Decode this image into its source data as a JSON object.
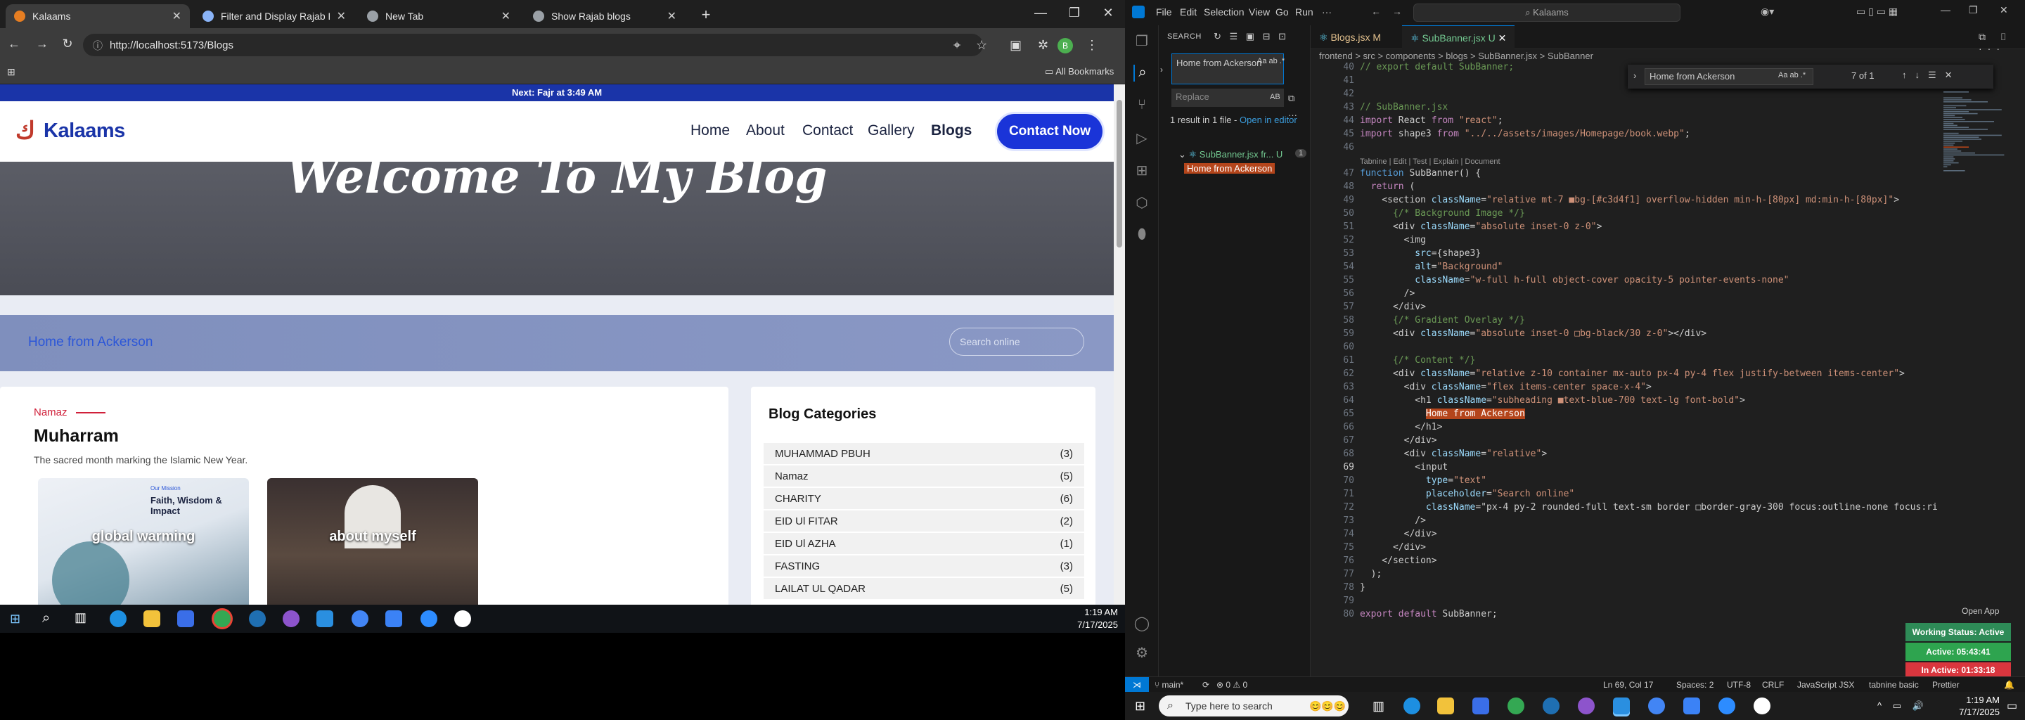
{
  "chrome": {
    "tabs": [
      {
        "title": "Kalaams",
        "active": true,
        "fav_color": "#e67e22"
      },
      {
        "title": "Filter and Display Rajab Blog In",
        "active": false,
        "fav_color": "#8ab4f8"
      },
      {
        "title": "New Tab",
        "active": false,
        "fav_color": "#9aa0a6"
      },
      {
        "title": "Show Rajab blogs",
        "active": false,
        "fav_color": "#9aa0a6"
      }
    ],
    "url": "http://localhost:5173/Blogs",
    "all_bookmarks": "All Bookmarks",
    "profile_initial": "B"
  },
  "site": {
    "prayer_banner": "Next: Fajr at 3:49 AM",
    "logo_text": "Kalaams",
    "nav": [
      "Home",
      "About",
      "Contact",
      "Gallery",
      "Blogs"
    ],
    "contact_button": "Contact Now",
    "hero_heading": "Welcome To My Blog",
    "subbanner_heading": "Home from Ackerson",
    "search_placeholder": "Search online",
    "post": {
      "category": "Namaz",
      "title": "Muharram",
      "description": "The sacred month marking the Islamic New Year.",
      "thumbs": [
        {
          "label": "global warming",
          "small_text": "Our Mission",
          "small_title": "Faith, Wisdom & Impact"
        },
        {
          "label": "about myself"
        }
      ]
    },
    "categories_title": "Blog Categories",
    "categories": [
      {
        "name": "MUHAMMAD PBUH",
        "count": "(3)"
      },
      {
        "name": "Namaz",
        "count": "(5)"
      },
      {
        "name": "CHARITY",
        "count": "(6)"
      },
      {
        "name": "EID Ul FITAR",
        "count": "(2)"
      },
      {
        "name": "EID Ul AZHA",
        "count": "(1)"
      },
      {
        "name": "FASTING",
        "count": "(3)"
      },
      {
        "name": "LAILAT UL QADAR",
        "count": "(5)"
      }
    ]
  },
  "taskbar_left": {
    "time": "1:19 AM",
    "date": "7/17/2025"
  },
  "vscode": {
    "menu": [
      "File",
      "Edit",
      "Selection",
      "View",
      "Go",
      "Run",
      "···"
    ],
    "command_center": "Kalaams",
    "sidebar": {
      "title": "SEARCH",
      "find_value": "Home from Ackerson",
      "replace_placeholder": "Replace",
      "replace_toggle": "AB",
      "result_summary": "1 result in 1 file - ",
      "open_in_editor": "Open in editor",
      "file_name": "SubBanner.jsx fr... U",
      "file_count": "1",
      "match": "Home from Ackerson",
      "find_options": "Aa ab .*"
    },
    "tabs": [
      {
        "title": "Blogs.jsx M",
        "active": false
      },
      {
        "title": "SubBanner.jsx U",
        "active": true
      }
    ],
    "breadcrumb": "frontend > src > components > blogs > SubBanner.jsx > SubBanner",
    "find_widget": {
      "value": "Home from Ackerson",
      "options": "Aa ab .*",
      "count": "7 of 1"
    },
    "tabnine_hint": "Tabnine | Edit | Test | Explain | Document",
    "lines": [
      {
        "n": "40",
        "text": "// export default SubBanner;",
        "cls": "c"
      },
      {
        "n": "41",
        "text": "",
        "cls": ""
      },
      {
        "n": "42",
        "text": "",
        "cls": ""
      },
      {
        "n": "43",
        "text": "// SubBanner.jsx",
        "cls": "c"
      },
      {
        "n": "44",
        "text": "import React from \"react\";",
        "cls": ""
      },
      {
        "n": "45",
        "text": "import shape3 from \"../../assets/images/Homepage/book.webp\";",
        "cls": ""
      },
      {
        "n": "46",
        "text": "",
        "cls": ""
      },
      {
        "n": "47",
        "text": "function SubBanner() {",
        "cls": ""
      },
      {
        "n": "48",
        "text": "  return (",
        "cls": ""
      },
      {
        "n": "49",
        "text": "    <section className=\"relative mt-7 ■bg-[#c3d4f1] overflow-hidden min-h-[80px] md:min-h-[80px]\">",
        "cls": ""
      },
      {
        "n": "50",
        "text": "      {/* Background Image */}",
        "cls": "c"
      },
      {
        "n": "51",
        "text": "      <div className=\"absolute inset-0 z-0\">",
        "cls": ""
      },
      {
        "n": "52",
        "text": "        <img",
        "cls": ""
      },
      {
        "n": "53",
        "text": "          src={shape3}",
        "cls": ""
      },
      {
        "n": "54",
        "text": "          alt=\"Background\"",
        "cls": ""
      },
      {
        "n": "55",
        "text": "          className=\"w-full h-full object-cover opacity-5 pointer-events-none\"",
        "cls": ""
      },
      {
        "n": "56",
        "text": "        />",
        "cls": ""
      },
      {
        "n": "57",
        "text": "      </div>",
        "cls": ""
      },
      {
        "n": "58",
        "text": "      {/* Gradient Overlay */}",
        "cls": "c"
      },
      {
        "n": "59",
        "text": "      <div className=\"absolute inset-0 □bg-black/30 z-0\"></div>",
        "cls": ""
      },
      {
        "n": "60",
        "text": "",
        "cls": ""
      },
      {
        "n": "61",
        "text": "      {/* Content */}",
        "cls": "c"
      },
      {
        "n": "62",
        "text": "      <div className=\"relative z-10 container mx-auto px-4 py-4 flex justify-between items-center\">",
        "cls": ""
      },
      {
        "n": "63",
        "text": "        <div className=\"flex items-center space-x-4\">",
        "cls": ""
      },
      {
        "n": "64",
        "text": "          <h1 className=\"subheading ■text-blue-700 text-lg font-bold\">",
        "cls": ""
      },
      {
        "n": "65",
        "text": "            Home from Ackerson",
        "cls": "hl"
      },
      {
        "n": "66",
        "text": "          </h1>",
        "cls": ""
      },
      {
        "n": "67",
        "text": "        </div>",
        "cls": ""
      },
      {
        "n": "68",
        "text": "        <div className=\"relative\">",
        "cls": ""
      },
      {
        "n": "69",
        "text": "          <input",
        "cls": ""
      },
      {
        "n": "70",
        "text": "            type=\"text\"",
        "cls": ""
      },
      {
        "n": "71",
        "text": "            placeholder=\"Search online\"",
        "cls": ""
      },
      {
        "n": "72",
        "text": "            className=\"px-4 py-2 rounded-full text-sm border □border-gray-300 focus:outline-none focus:ri",
        "cls": ""
      },
      {
        "n": "73",
        "text": "          />",
        "cls": ""
      },
      {
        "n": "74",
        "text": "        </div>",
        "cls": ""
      },
      {
        "n": "75",
        "text": "      </div>",
        "cls": ""
      },
      {
        "n": "76",
        "text": "    </section>",
        "cls": ""
      },
      {
        "n": "77",
        "text": "  );",
        "cls": ""
      },
      {
        "n": "78",
        "text": "}",
        "cls": ""
      },
      {
        "n": "79",
        "text": "",
        "cls": ""
      },
      {
        "n": "80",
        "text": "export default SubBanner;",
        "cls": ""
      }
    ],
    "open_app": "Open App",
    "working_status": [
      "Working Status: Active",
      "Active: 05:43:41",
      "In Active: 01:33:18"
    ],
    "status": {
      "branch": "main*",
      "problems": "⊗ 0 ⚠ 0",
      "position": "Ln 69, Col 17",
      "spaces": "Spaces: 2",
      "encoding": "UTF-8",
      "eol": "CRLF",
      "language": "JavaScript JSX",
      "tabnine": "tabnine basic",
      "prettier": "Prettier"
    }
  },
  "taskbar_right": {
    "search_placeholder": "Type here to search",
    "time": "1:19 AM",
    "date": "7/17/2025"
  }
}
